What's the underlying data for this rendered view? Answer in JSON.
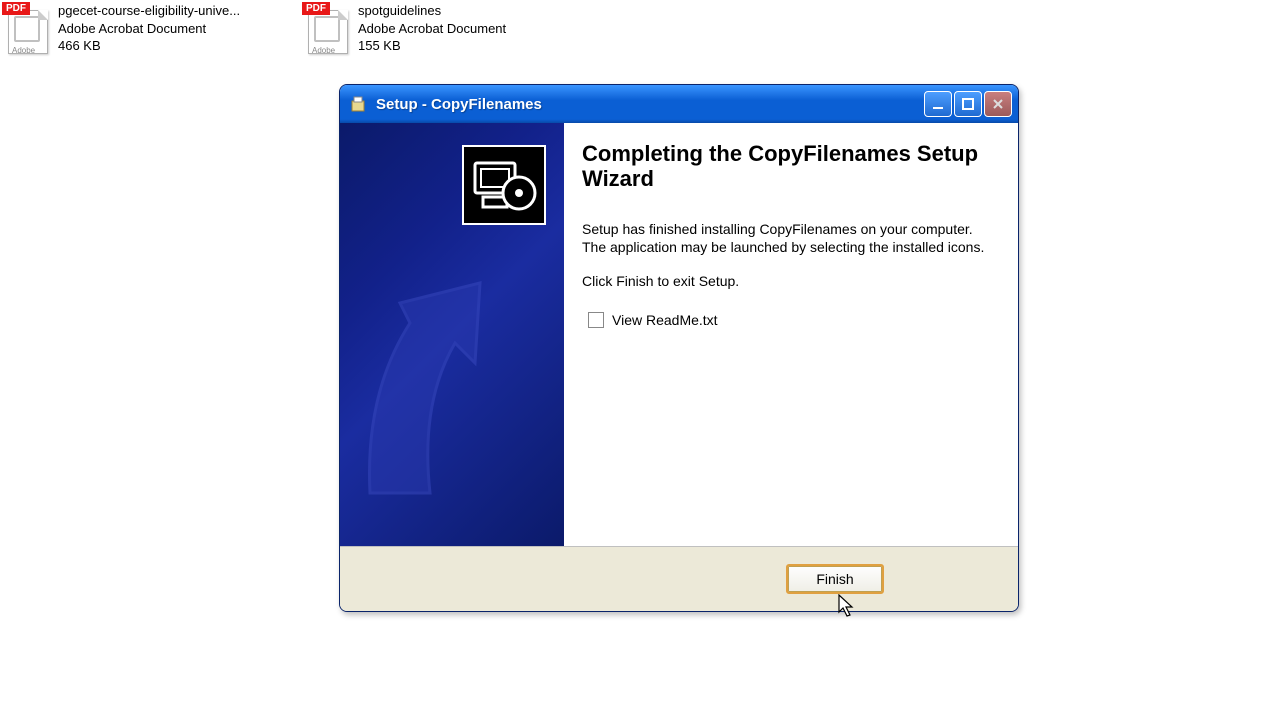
{
  "desktop": {
    "files": [
      {
        "name": "pgecet-course-eligibility-unive...",
        "type": "Adobe Acrobat Document",
        "size": "466 KB"
      },
      {
        "name": "spotguidelines",
        "type": "Adobe Acrobat Document",
        "size": "155 KB"
      }
    ]
  },
  "dialog": {
    "title": "Setup - CopyFilenames",
    "heading": "Completing the CopyFilenames Setup Wizard",
    "body1": "Setup has finished installing CopyFilenames on your computer. The application may be launched by selecting the installed icons.",
    "body2": "Click Finish to exit Setup.",
    "checkbox_label": "View ReadMe.txt",
    "checkbox_checked": false,
    "finish_label": "Finish"
  },
  "colors": {
    "titlebar_blue": "#0b5fd4",
    "side_panel_navy": "#0b1a6a",
    "button_highlight": "#e0a040"
  }
}
